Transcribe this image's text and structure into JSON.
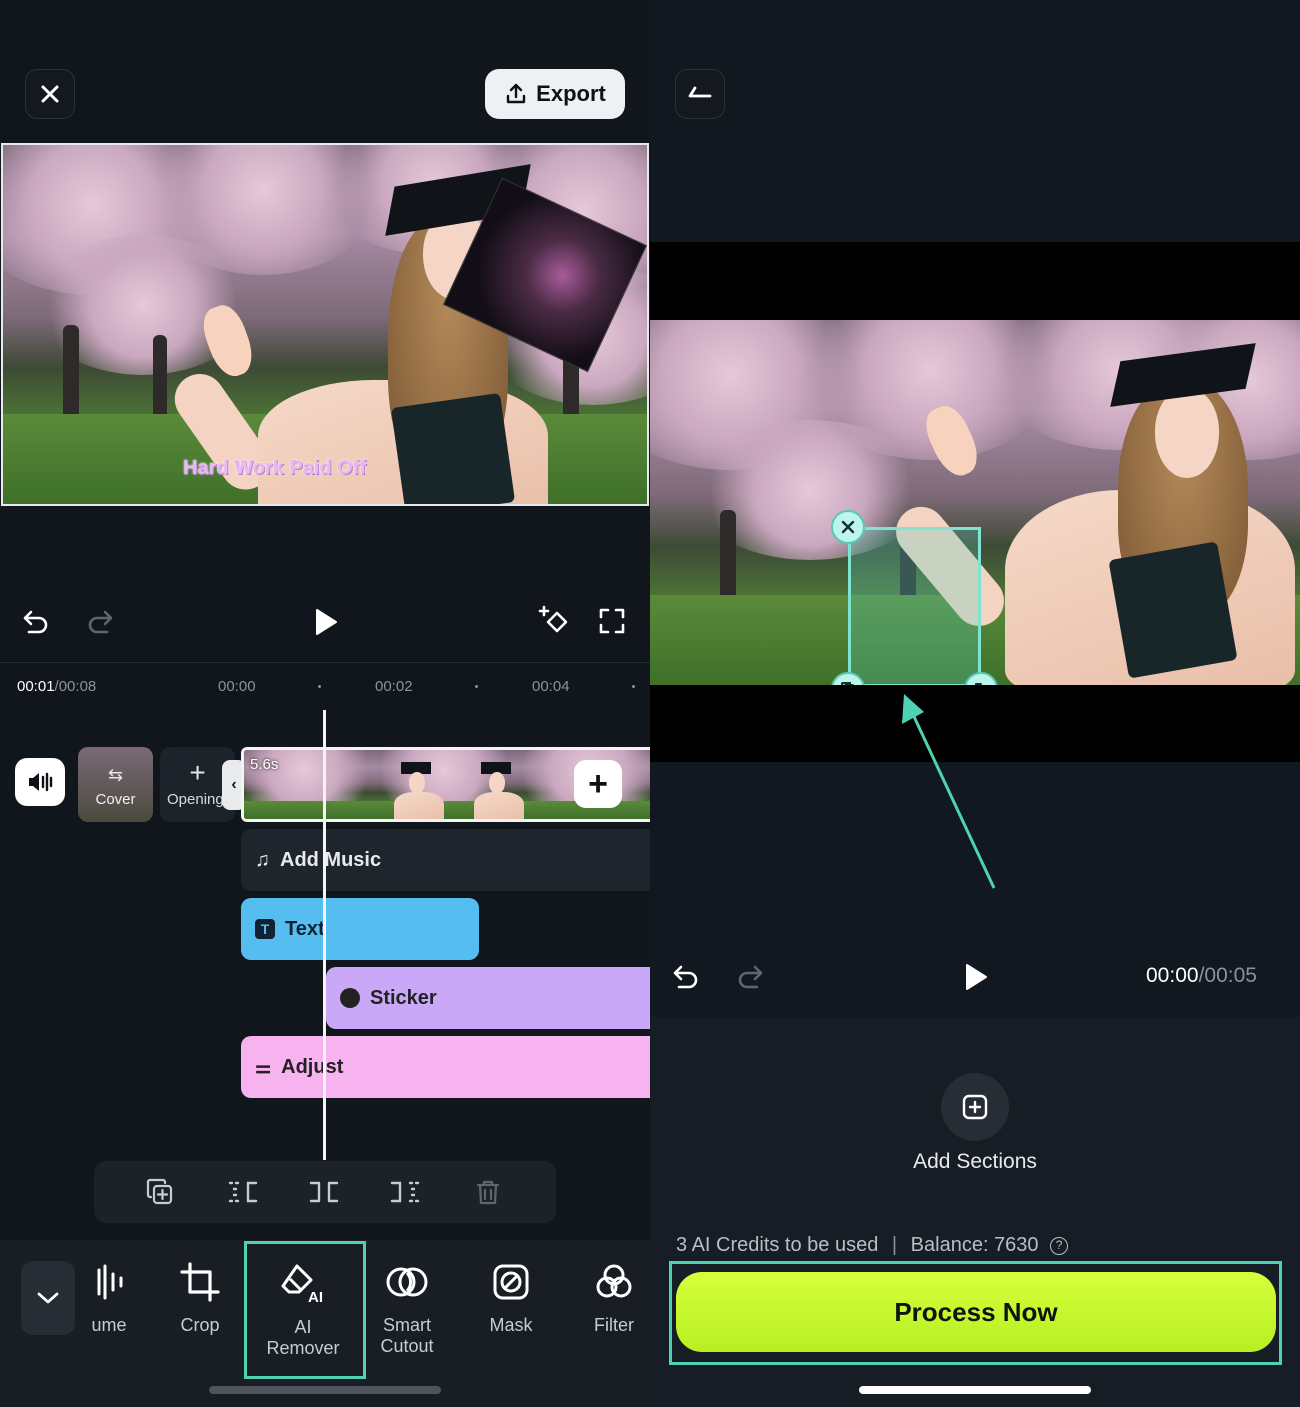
{
  "left": {
    "header": {
      "close_label": "close",
      "export_label": "Export"
    },
    "preview": {
      "caption": "Hard Work Paid Off"
    },
    "timeline": {
      "current": "00:01",
      "total": "/00:08",
      "ruler": [
        "00:00",
        "00:02",
        "00:04"
      ],
      "clip_duration": "5.6s",
      "cover_label": "Cover",
      "opening_label": "Opening"
    },
    "tracks": {
      "music": "Add Music",
      "text": "Text",
      "sticker": "Sticker",
      "adjust": "Adjust"
    },
    "toolbar": [
      {
        "icon": "volume-icon",
        "label": "ume"
      },
      {
        "icon": "crop-icon",
        "label": "Crop"
      },
      {
        "icon": "ai-remover-icon",
        "label": "AI\nRemover"
      },
      {
        "icon": "smart-cutout-icon",
        "label": "Smart\nCutout"
      },
      {
        "icon": "mask-icon",
        "label": "Mask"
      },
      {
        "icon": "filter-icon",
        "label": "Filter"
      }
    ],
    "highlight_color": "#4fd1b4"
  },
  "right": {
    "time_current": "00:00",
    "time_total": "/00:05",
    "add_sections_label": "Add Sections",
    "credits_text": "3 AI Credits to be used",
    "balance_text": "Balance: 7630",
    "process_label": "Process Now",
    "accent_color": "#c4f42c"
  }
}
